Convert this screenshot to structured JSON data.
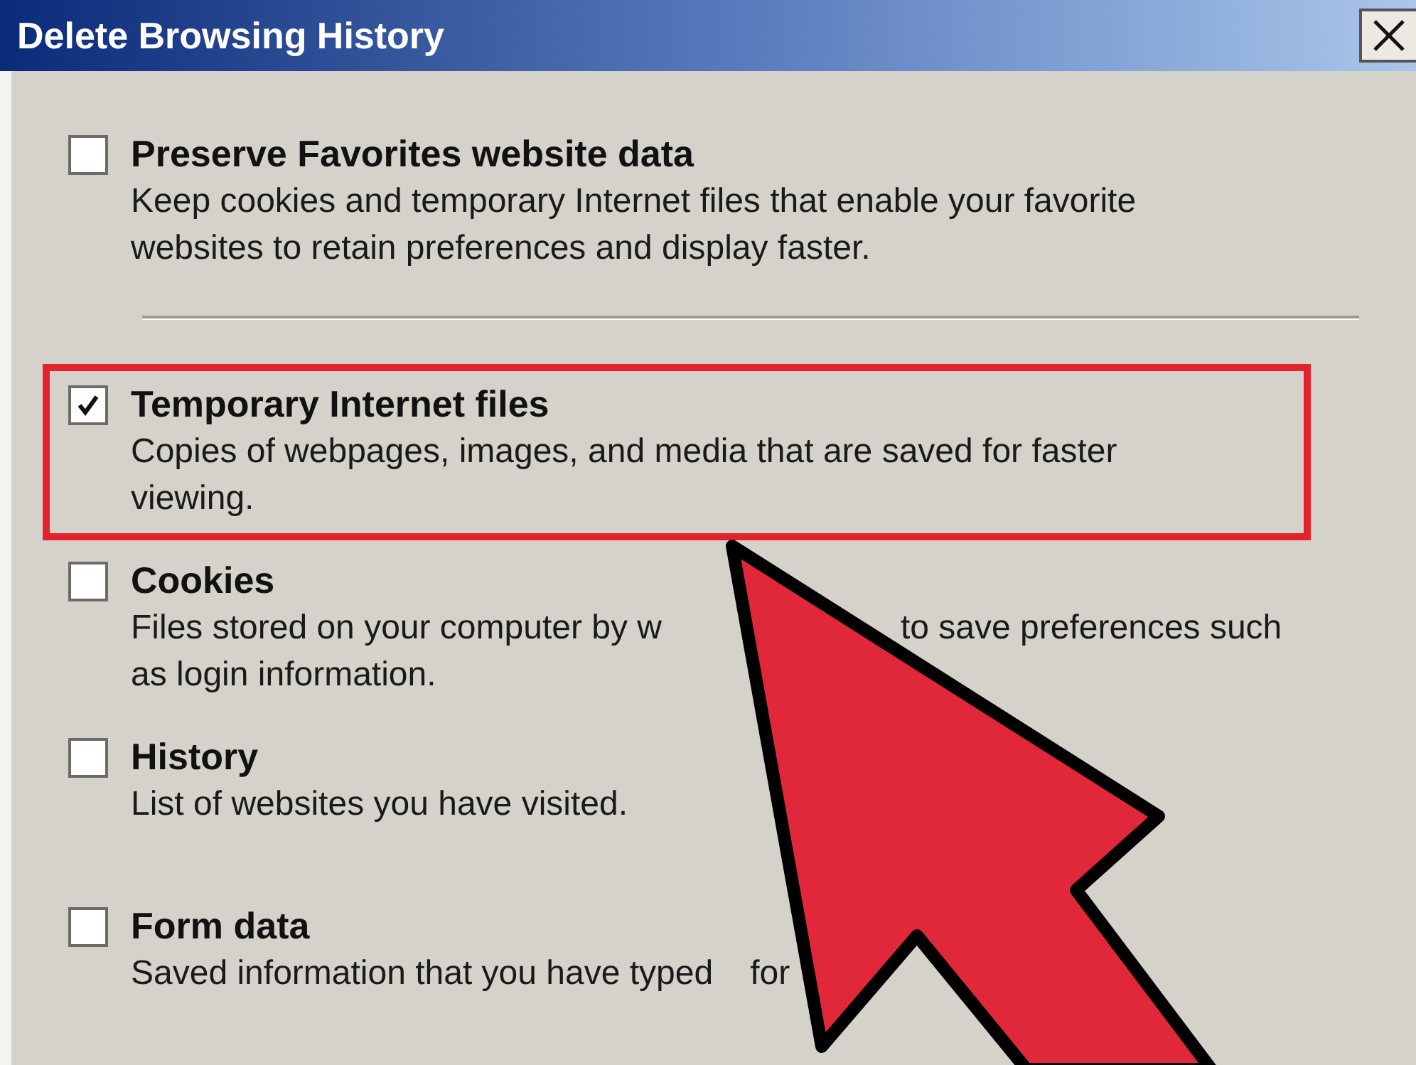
{
  "window": {
    "title": "Delete Browsing History"
  },
  "items": [
    {
      "label": "Preserve Favorites website data",
      "checked": false,
      "highlighted": false,
      "description": [
        [
          "Keep cookies and temporary Internet files that enable your favorite"
        ],
        [
          "websites to retain preferences and display faster."
        ]
      ]
    },
    {
      "label": "Temporary Internet files",
      "checked": true,
      "highlighted": true,
      "description": [
        [
          "Copies of webpages, images, and media that are saved for faster"
        ],
        [
          "viewing."
        ]
      ]
    },
    {
      "label": "Cookies",
      "checked": false,
      "highlighted": false,
      "description": [
        [
          "Files stored on your computer by w",
          "to save preferences such"
        ],
        [
          "as login information."
        ]
      ]
    },
    {
      "label": "History",
      "checked": false,
      "highlighted": false,
      "description": [
        [
          "List of websites you have visited."
        ]
      ]
    },
    {
      "label": "Form data",
      "checked": false,
      "highlighted": false,
      "description": [
        [
          "Saved information that you have typed",
          "for"
        ]
      ]
    }
  ]
}
